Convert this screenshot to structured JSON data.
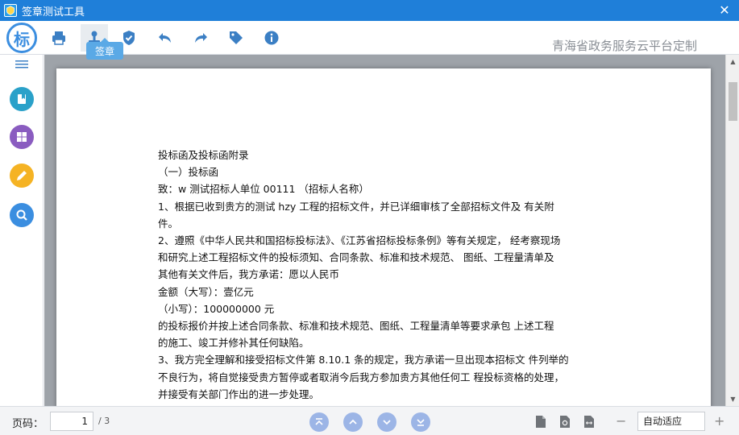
{
  "window": {
    "title": "签章测试工具",
    "close_glyph": "✕"
  },
  "toolbar": {
    "logo_text": "标",
    "items": [
      {
        "name": "print-icon"
      },
      {
        "name": "sign-icon"
      },
      {
        "name": "verify-icon"
      },
      {
        "name": "undo-icon"
      },
      {
        "name": "redo-icon"
      },
      {
        "name": "tag-icon"
      },
      {
        "name": "info-icon"
      }
    ],
    "tooltip": "签章",
    "brand": "青海省政务服务云平台定制"
  },
  "sidebar": {
    "buttons": [
      {
        "name": "bookmark-icon",
        "color": "#2aa1c9"
      },
      {
        "name": "grid-icon",
        "color": "#8a5cc0"
      },
      {
        "name": "pen-icon",
        "color": "#f5b324"
      },
      {
        "name": "search-icon",
        "color": "#3b8ee0"
      }
    ]
  },
  "document": {
    "lines": [
      "投标函及投标函附录",
      "（一）投标函",
      "致：w 测试招标人单位 00111 （招标人名称）",
      "1、根据已收到贵方的测试 hzy 工程的招标文件，并已详细审核了全部招标文件及 有关附",
      "件。",
      "2、遵照《中华人民共和国招标投标法》、《江苏省招标投标条例》等有关规定， 经考察现场",
      "和研究上述工程招标文件的投标须知、合同条款、标准和技术规范、 图纸、工程量清单及",
      "其他有关文件后，我方承诺：愿以人民币",
      "金额（大写）：壹亿元",
      "（小写）：100000000 元",
      "的投标报价并按上述合同条款、标准和技术规范、图纸、工程量清单等要求承包 上述工程",
      "的施工、竣工并修补其任何缺陷。",
      "3、我方完全理解和接受招标文件第 8.10.1 条的规定，我方承诺一旦出现本招标文 件列举的",
      "不良行为，将自觉接受贵方暂停或者取消今后我方参加贵方其他任何工 程投标资格的处理，",
      "并接受有关部门作出的进一步处理。"
    ]
  },
  "bottombar": {
    "page_label": "页码：",
    "current_page": "1",
    "total_pages": "/ 3",
    "zoom_minus": "−",
    "zoom_value": "自动适应",
    "zoom_plus": "+"
  },
  "colors": {
    "accent": "#1f7fd9",
    "nav_button": "#9cb5e6"
  }
}
